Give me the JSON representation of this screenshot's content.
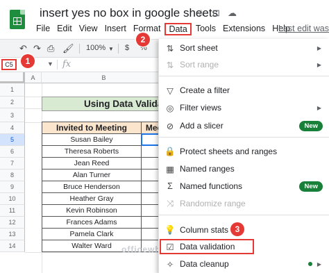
{
  "doc": {
    "title": "insert yes no box in google sheets",
    "last_edit": "Last edit was"
  },
  "menu": [
    "File",
    "Edit",
    "View",
    "Insert",
    "Format",
    "Data",
    "Tools",
    "Extensions",
    "Help"
  ],
  "toolbar": {
    "zoom": "100%",
    "currency": "$",
    "percent": "%"
  },
  "formula": {
    "cell_ref": "C5",
    "fx": "fx"
  },
  "badges": [
    "1",
    "2",
    "3"
  ],
  "grid": {
    "columns": [
      "A",
      "B"
    ],
    "rows": [
      "1",
      "2",
      "3",
      "4",
      "5",
      "6",
      "7",
      "8",
      "9",
      "10",
      "11",
      "12",
      "13",
      "14"
    ],
    "title": "Using Data Valida",
    "headers": [
      "Invited to Meeting",
      "Mee"
    ],
    "names": [
      "Susan Bailey",
      "Theresa Roberts",
      "Jean Reed",
      "Alan Turner",
      "Bruce Henderson",
      "Heather Gray",
      "Kevin Robinson",
      "Frances Adams",
      "Pamela Clark",
      "Walter Ward"
    ]
  },
  "watermark": "officewheel",
  "data_menu": {
    "sort_sheet": "Sort sheet",
    "sort_range": "Sort range",
    "create_filter": "Create a filter",
    "filter_views": "Filter views",
    "add_slicer": "Add a slicer",
    "protect": "Protect sheets and ranges",
    "named_ranges": "Named ranges",
    "named_functions": "Named functions",
    "randomize": "Randomize range",
    "column_stats": "Column stats",
    "data_validation": "Data validation",
    "data_cleanup": "Data cleanup",
    "new_badge": "New"
  }
}
